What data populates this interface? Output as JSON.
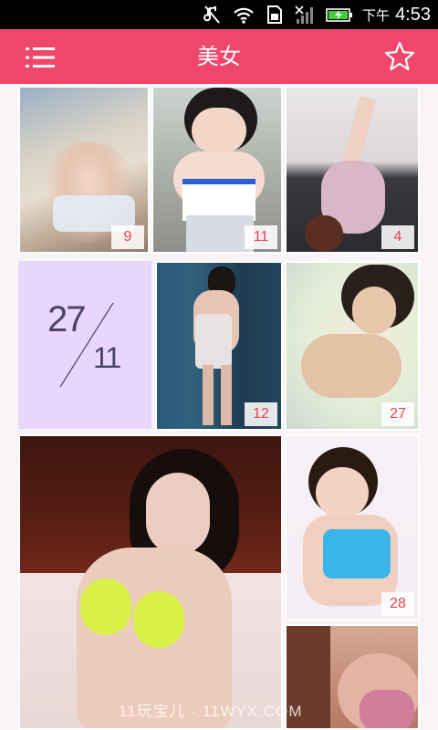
{
  "status_bar": {
    "ampm": "下午",
    "time": "4:53",
    "icons": [
      "muted-icon",
      "wifi-icon",
      "sim-icon",
      "signal-icon",
      "battery-charging-icon"
    ],
    "battery_color": "#3fcf36"
  },
  "app_bar": {
    "title": "美女",
    "menu_icon": "menu-icon",
    "favorite_icon": "star-outline-icon",
    "background": "#f1466b"
  },
  "grid": {
    "tiles": [
      {
        "count": "9"
      },
      {
        "count": "11"
      },
      {
        "count": "4"
      },
      {
        "count": "12"
      },
      {
        "count": "27"
      },
      {
        "count": "28"
      },
      {
        "count": ""
      },
      {
        "count": ""
      }
    ],
    "date_tile": {
      "day": "27",
      "month": "11",
      "background": "#e9d7fb"
    }
  },
  "watermark": "11玩宝儿 · 11WYX.COM"
}
